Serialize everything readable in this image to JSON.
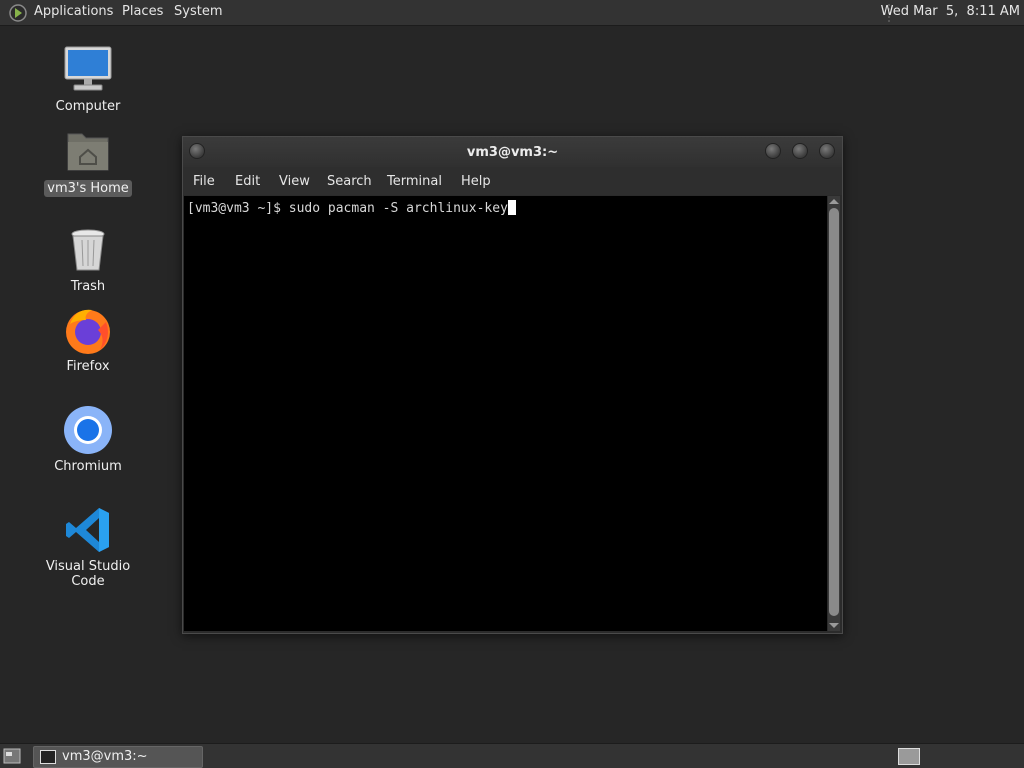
{
  "top_panel": {
    "menus": [
      "Applications",
      "Places",
      "System"
    ],
    "clock": "Wed Mar  5,  8:11 AM",
    "logo_icon": "mate-logo-icon"
  },
  "desktop": {
    "icons": [
      {
        "label": "Computer",
        "icon": "computer-icon"
      },
      {
        "label": "vm3's Home",
        "icon": "home-folder-icon",
        "selected": true
      },
      {
        "label": "Trash",
        "icon": "trash-icon"
      },
      {
        "label": "Firefox",
        "icon": "firefox-icon"
      },
      {
        "label": "Chromium",
        "icon": "chromium-icon"
      },
      {
        "label": "Visual Studio Code",
        "icon": "vscode-icon"
      }
    ]
  },
  "terminal_window": {
    "title": "vm3@vm3:~",
    "menu": [
      "File",
      "Edit",
      "View",
      "Search",
      "Terminal",
      "Help"
    ],
    "prompt": "[vm3@vm3 ~]$ ",
    "command": "sudo pacman -S archlinux-key"
  },
  "bottom_panel": {
    "task_label": "vm3@vm3:~"
  },
  "colors": {
    "desktop_bg": "#262626",
    "panel_bg": "#333333",
    "terminal_bg": "#000000",
    "terminal_fg": "#d8d8d8"
  }
}
